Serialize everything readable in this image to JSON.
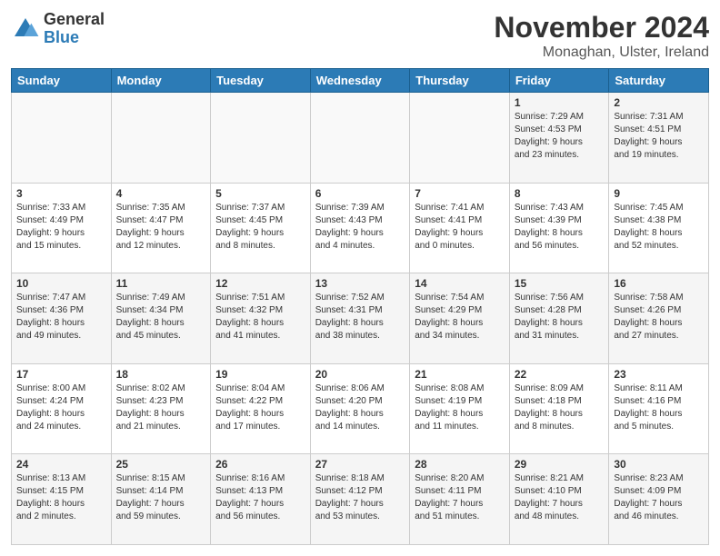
{
  "header": {
    "logo": {
      "line1": "General",
      "line2": "Blue"
    },
    "title": "November 2024",
    "location": "Monaghan, Ulster, Ireland"
  },
  "weekdays": [
    "Sunday",
    "Monday",
    "Tuesday",
    "Wednesday",
    "Thursday",
    "Friday",
    "Saturday"
  ],
  "weeks": [
    [
      {
        "day": "",
        "info": ""
      },
      {
        "day": "",
        "info": ""
      },
      {
        "day": "",
        "info": ""
      },
      {
        "day": "",
        "info": ""
      },
      {
        "day": "",
        "info": ""
      },
      {
        "day": "1",
        "info": "Sunrise: 7:29 AM\nSunset: 4:53 PM\nDaylight: 9 hours\nand 23 minutes."
      },
      {
        "day": "2",
        "info": "Sunrise: 7:31 AM\nSunset: 4:51 PM\nDaylight: 9 hours\nand 19 minutes."
      }
    ],
    [
      {
        "day": "3",
        "info": "Sunrise: 7:33 AM\nSunset: 4:49 PM\nDaylight: 9 hours\nand 15 minutes."
      },
      {
        "day": "4",
        "info": "Sunrise: 7:35 AM\nSunset: 4:47 PM\nDaylight: 9 hours\nand 12 minutes."
      },
      {
        "day": "5",
        "info": "Sunrise: 7:37 AM\nSunset: 4:45 PM\nDaylight: 9 hours\nand 8 minutes."
      },
      {
        "day": "6",
        "info": "Sunrise: 7:39 AM\nSunset: 4:43 PM\nDaylight: 9 hours\nand 4 minutes."
      },
      {
        "day": "7",
        "info": "Sunrise: 7:41 AM\nSunset: 4:41 PM\nDaylight: 9 hours\nand 0 minutes."
      },
      {
        "day": "8",
        "info": "Sunrise: 7:43 AM\nSunset: 4:39 PM\nDaylight: 8 hours\nand 56 minutes."
      },
      {
        "day": "9",
        "info": "Sunrise: 7:45 AM\nSunset: 4:38 PM\nDaylight: 8 hours\nand 52 minutes."
      }
    ],
    [
      {
        "day": "10",
        "info": "Sunrise: 7:47 AM\nSunset: 4:36 PM\nDaylight: 8 hours\nand 49 minutes."
      },
      {
        "day": "11",
        "info": "Sunrise: 7:49 AM\nSunset: 4:34 PM\nDaylight: 8 hours\nand 45 minutes."
      },
      {
        "day": "12",
        "info": "Sunrise: 7:51 AM\nSunset: 4:32 PM\nDaylight: 8 hours\nand 41 minutes."
      },
      {
        "day": "13",
        "info": "Sunrise: 7:52 AM\nSunset: 4:31 PM\nDaylight: 8 hours\nand 38 minutes."
      },
      {
        "day": "14",
        "info": "Sunrise: 7:54 AM\nSunset: 4:29 PM\nDaylight: 8 hours\nand 34 minutes."
      },
      {
        "day": "15",
        "info": "Sunrise: 7:56 AM\nSunset: 4:28 PM\nDaylight: 8 hours\nand 31 minutes."
      },
      {
        "day": "16",
        "info": "Sunrise: 7:58 AM\nSunset: 4:26 PM\nDaylight: 8 hours\nand 27 minutes."
      }
    ],
    [
      {
        "day": "17",
        "info": "Sunrise: 8:00 AM\nSunset: 4:24 PM\nDaylight: 8 hours\nand 24 minutes."
      },
      {
        "day": "18",
        "info": "Sunrise: 8:02 AM\nSunset: 4:23 PM\nDaylight: 8 hours\nand 21 minutes."
      },
      {
        "day": "19",
        "info": "Sunrise: 8:04 AM\nSunset: 4:22 PM\nDaylight: 8 hours\nand 17 minutes."
      },
      {
        "day": "20",
        "info": "Sunrise: 8:06 AM\nSunset: 4:20 PM\nDaylight: 8 hours\nand 14 minutes."
      },
      {
        "day": "21",
        "info": "Sunrise: 8:08 AM\nSunset: 4:19 PM\nDaylight: 8 hours\nand 11 minutes."
      },
      {
        "day": "22",
        "info": "Sunrise: 8:09 AM\nSunset: 4:18 PM\nDaylight: 8 hours\nand 8 minutes."
      },
      {
        "day": "23",
        "info": "Sunrise: 8:11 AM\nSunset: 4:16 PM\nDaylight: 8 hours\nand 5 minutes."
      }
    ],
    [
      {
        "day": "24",
        "info": "Sunrise: 8:13 AM\nSunset: 4:15 PM\nDaylight: 8 hours\nand 2 minutes."
      },
      {
        "day": "25",
        "info": "Sunrise: 8:15 AM\nSunset: 4:14 PM\nDaylight: 7 hours\nand 59 minutes."
      },
      {
        "day": "26",
        "info": "Sunrise: 8:16 AM\nSunset: 4:13 PM\nDaylight: 7 hours\nand 56 minutes."
      },
      {
        "day": "27",
        "info": "Sunrise: 8:18 AM\nSunset: 4:12 PM\nDaylight: 7 hours\nand 53 minutes."
      },
      {
        "day": "28",
        "info": "Sunrise: 8:20 AM\nSunset: 4:11 PM\nDaylight: 7 hours\nand 51 minutes."
      },
      {
        "day": "29",
        "info": "Sunrise: 8:21 AM\nSunset: 4:10 PM\nDaylight: 7 hours\nand 48 minutes."
      },
      {
        "day": "30",
        "info": "Sunrise: 8:23 AM\nSunset: 4:09 PM\nDaylight: 7 hours\nand 46 minutes."
      }
    ]
  ]
}
